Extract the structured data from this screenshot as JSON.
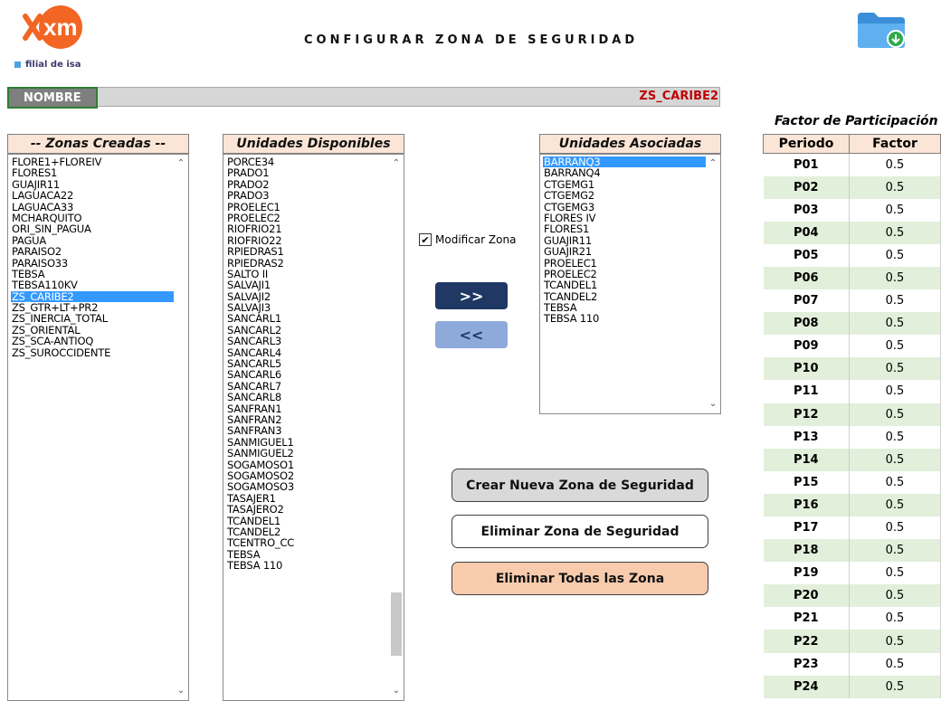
{
  "header": {
    "logo_text": "xm",
    "logo_sub": "filial de isa",
    "title": "CONFIGURAR ZONA DE SEGURIDAD",
    "folder_icon": "folder-download-icon"
  },
  "name": {
    "label": "NOMBRE",
    "value": "ZS_CARIBE2"
  },
  "zonas": {
    "header": "-- Zonas Creadas --",
    "items": [
      "FLORE1+FLOREIV",
      "FLORES1",
      "GUAJIR11",
      "LAGUACA22",
      "LAGUACA33",
      "MCHARQUITO",
      "ORI_SIN_PAGUA",
      "PAGUA",
      "PARAISO2",
      "PARAISO33",
      "TEBSA",
      "TEBSA110KV",
      "ZS_CARIBE2",
      "ZS_GTR+LT+PR2",
      "ZS_INERCIA_TOTAL",
      "ZS_ORIENTAL",
      "ZS_SCA-ANTIOQ",
      "ZS_SUROCCIDENTE"
    ],
    "selected": "ZS_CARIBE2"
  },
  "disponibles": {
    "header": "Unidades Disponibles",
    "items": [
      "PORCE34",
      "PRADO1",
      "PRADO2",
      "PRADO3",
      "PROELEC1",
      "PROELEC2",
      "RIOFRIO21",
      "RIOFRIO22",
      "RPIEDRAS1",
      "RPIEDRAS2",
      "SALTO II",
      "SALVAJI1",
      "SALVAJI2",
      "SALVAJI3",
      "SANCARL1",
      "SANCARL2",
      "SANCARL3",
      "SANCARL4",
      "SANCARL5",
      "SANCARL6",
      "SANCARL7",
      "SANCARL8",
      "SANFRAN1",
      "SANFRAN2",
      "SANFRAN3",
      "SANMIGUEL1",
      "SANMIGUEL2",
      "SOGAMOSO1",
      "SOGAMOSO2",
      "SOGAMOSO3",
      "TASAJER1",
      "TASAJERO2",
      "TCANDEL1",
      "TCANDEL2",
      "TCENTRO_CC",
      "TEBSA",
      "TEBSA 110"
    ]
  },
  "asociadas": {
    "header": "Unidades Asociadas",
    "items": [
      "BARRANQ3",
      "BARRANQ4",
      "CTGEMG1",
      "CTGEMG2",
      "CTGEMG3",
      "FLORES IV",
      "FLORES1",
      "GUAJIR11",
      "GUAJIR21",
      "PROELEC1",
      "PROELEC2",
      "TCANDEL1",
      "TCANDEL2",
      "TEBSA",
      "TEBSA 110"
    ],
    "selected": "BARRANQ3"
  },
  "controls": {
    "modificar_label": "Modificar Zona",
    "modificar_checked": true,
    "add_label": ">>",
    "remove_label": "<<",
    "crear_label": "Crear Nueva Zona de Seguridad",
    "eliminar_label": "Eliminar Zona de Seguridad",
    "eliminar_todas_label": "Eliminar Todas las Zona"
  },
  "factor": {
    "title": "Factor de Participación",
    "col_periodo": "Periodo",
    "col_factor": "Factor",
    "rows": [
      [
        "P01",
        "0.5"
      ],
      [
        "P02",
        "0.5"
      ],
      [
        "P03",
        "0.5"
      ],
      [
        "P04",
        "0.5"
      ],
      [
        "P05",
        "0.5"
      ],
      [
        "P06",
        "0.5"
      ],
      [
        "P07",
        "0.5"
      ],
      [
        "P08",
        "0.5"
      ],
      [
        "P09",
        "0.5"
      ],
      [
        "P10",
        "0.5"
      ],
      [
        "P11",
        "0.5"
      ],
      [
        "P12",
        "0.5"
      ],
      [
        "P13",
        "0.5"
      ],
      [
        "P14",
        "0.5"
      ],
      [
        "P15",
        "0.5"
      ],
      [
        "P16",
        "0.5"
      ],
      [
        "P17",
        "0.5"
      ],
      [
        "P18",
        "0.5"
      ],
      [
        "P19",
        "0.5"
      ],
      [
        "P20",
        "0.5"
      ],
      [
        "P21",
        "0.5"
      ],
      [
        "P22",
        "0.5"
      ],
      [
        "P23",
        "0.5"
      ],
      [
        "P24",
        "0.5"
      ]
    ]
  },
  "colors": {
    "brand_orange": "#f26522",
    "header_fill": "#fbe5d6",
    "selection": "#3399ff",
    "name_value": "#c00000",
    "dark_button": "#1f3864",
    "light_button": "#8eaadb",
    "row_alt": "#e2efda"
  }
}
